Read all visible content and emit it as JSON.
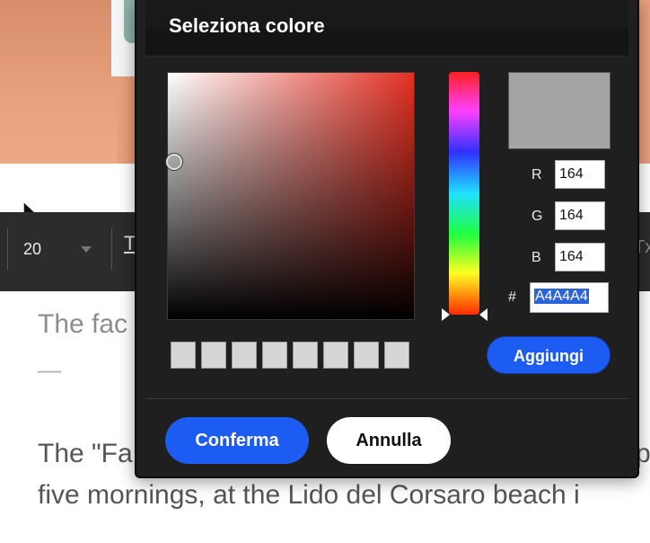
{
  "toolbar": {
    "font_size": "20",
    "text_format_glyph": "T",
    "clear_format_glyph": "Tx"
  },
  "content": {
    "heading_fragment": "The fac",
    "dash": "—",
    "paragraph_line1_left": "The \"Fa",
    "paragraph_line1_right": "p",
    "paragraph_line2": "five mornings, at the Lido del Corsaro beach i"
  },
  "color_dialog": {
    "title": "Seleziona colore",
    "current_color": "#a4a4a4",
    "r_label": "R",
    "g_label": "G",
    "b_label": "B",
    "hex_label": "#",
    "r_value": "164",
    "g_value": "164",
    "b_value": "164",
    "hex_value": "A4A4A4",
    "add_button": "Aggiungi",
    "confirm_button": "Conferma",
    "cancel_button": "Annulla",
    "swatches": [
      "#d6d6d6",
      "#d6d6d6",
      "#d6d6d6",
      "#d6d6d6",
      "#d6d6d6",
      "#d6d6d6",
      "#d6d6d6",
      "#d6d6d6"
    ]
  },
  "colors": {
    "accent_blue": "#1d5cf2",
    "dialog_bg": "#1f1f1f",
    "toolbar_bg": "#2c2c2c"
  }
}
